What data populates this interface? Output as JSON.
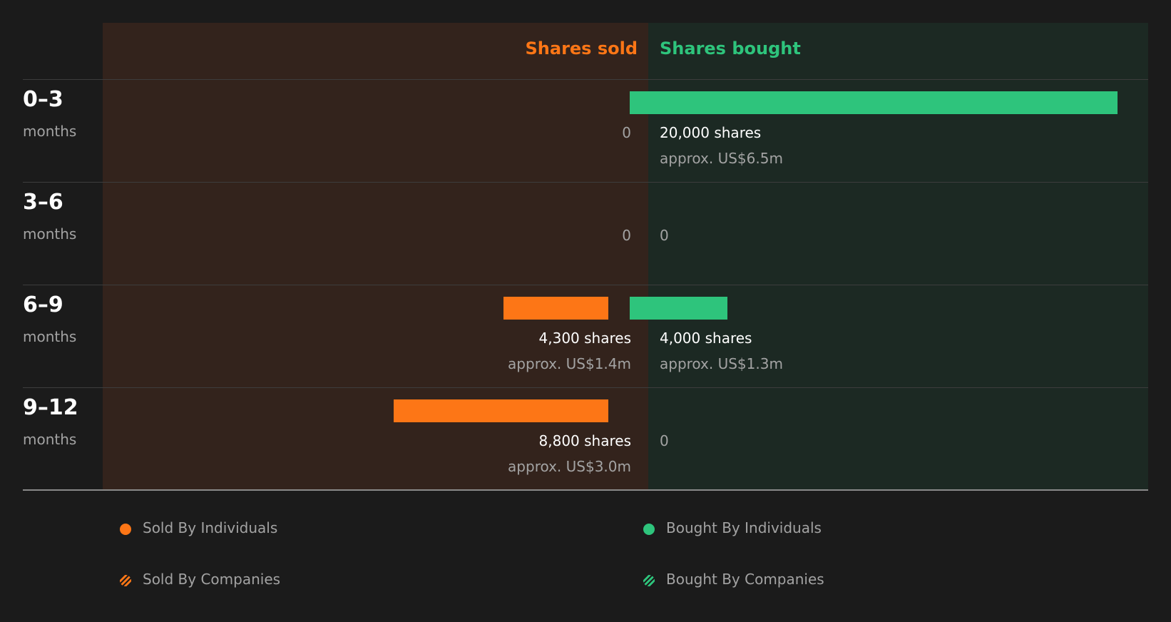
{
  "chart_data": {
    "type": "bar",
    "columns": {
      "sold_label": "Shares sold",
      "bought_label": "Shares bought"
    },
    "categories": [
      {
        "period": "0–3",
        "unit": "months"
      },
      {
        "period": "3–6",
        "unit": "months"
      },
      {
        "period": "6–9",
        "unit": "months"
      },
      {
        "period": "9–12",
        "unit": "months"
      }
    ],
    "max_value": 20000,
    "series": [
      {
        "name": "Shares sold",
        "color": "#fd7616",
        "values": [
          0,
          0,
          4300,
          8800
        ],
        "shares_text": [
          "0",
          "0",
          "4,300 shares",
          "8,800 shares"
        ],
        "approx_text": [
          "",
          "",
          "approx. US$1.4m",
          "approx. US$3.0m"
        ]
      },
      {
        "name": "Shares bought",
        "color": "#2ec47c",
        "values": [
          20000,
          0,
          4000,
          0
        ],
        "shares_text": [
          "20,000 shares",
          "0",
          "4,000 shares",
          "0"
        ],
        "approx_text": [
          "approx. US$6.5m",
          "",
          "approx. US$1.3m",
          ""
        ]
      }
    ]
  },
  "legend": {
    "items": [
      {
        "label": "Sold By Individuals",
        "color": "#fd7616",
        "style": "solid"
      },
      {
        "label": "Bought By Individuals",
        "color": "#2ec47c",
        "style": "solid"
      },
      {
        "label": "Sold By Companies",
        "color": "#fd7616",
        "style": "striped"
      },
      {
        "label": "Bought By Companies",
        "color": "#2ec47c",
        "style": "striped"
      }
    ]
  }
}
